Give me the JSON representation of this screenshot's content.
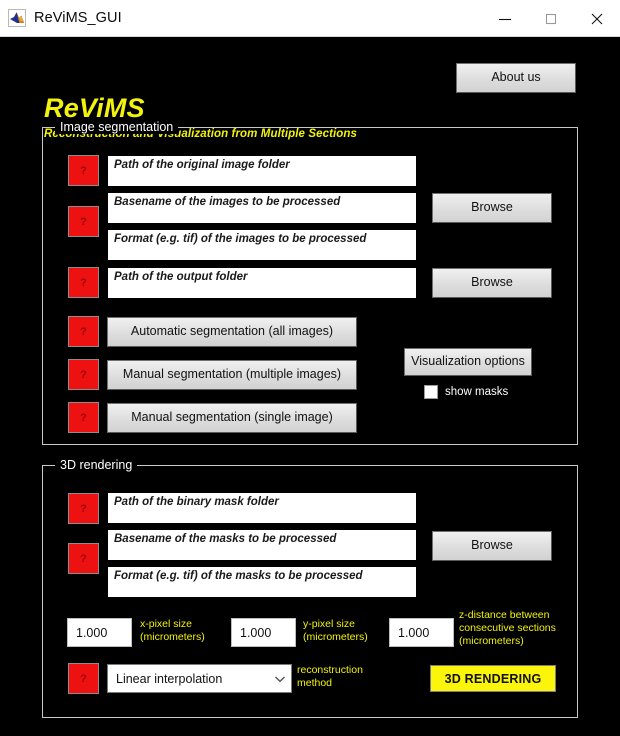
{
  "window": {
    "title": "ReViMS_GUI",
    "icon": "matlab-icon",
    "controls": {
      "minimize": "minimize-icon",
      "maximize": "maximize-icon",
      "close": "close-icon"
    }
  },
  "brand": {
    "title": "ReViMS",
    "subtitle": "Reconstruction and Visualization from Multiple Sections",
    "about_label": "About us",
    "title_color": "#f2f20d"
  },
  "segmentation": {
    "group_label": "Image segmentation",
    "help_label": "?",
    "fields": [
      {
        "name": "original-image-folder",
        "placeholder": "Path of the original image folder",
        "value": ""
      },
      {
        "name": "images-basename",
        "placeholder": "Basename of the images to be processed",
        "value": ""
      },
      {
        "name": "images-format",
        "placeholder": "Format (e.g. tif) of the images to be processed",
        "value": ""
      },
      {
        "name": "output-folder",
        "placeholder": "Path of the output folder",
        "value": ""
      }
    ],
    "browse_label": "Browse",
    "actions": [
      "Automatic segmentation (all images)",
      "Manual segmentation (multiple images)",
      "Manual segmentation (single image)"
    ],
    "visualization_options_label": "Visualization options",
    "show_masks_label": "show masks",
    "show_masks_checked": false
  },
  "rendering": {
    "group_label": "3D rendering",
    "help_label": "?",
    "fields": [
      {
        "name": "binary-mask-folder",
        "placeholder": "Path of the binary mask folder",
        "value": ""
      },
      {
        "name": "masks-basename",
        "placeholder": "Basename of the masks to be processed",
        "value": ""
      },
      {
        "name": "masks-format",
        "placeholder": "Format (e.g. tif) of the masks to be processed",
        "value": ""
      }
    ],
    "browse_label": "Browse",
    "x_pixel_value": "1.000",
    "x_pixel_label_line1": "x-pixel size",
    "x_pixel_label_line2": "(micrometers)",
    "y_pixel_value": "1.000",
    "y_pixel_label_line1": "y-pixel size",
    "y_pixel_label_line2": "(micrometers)",
    "z_distance_value": "1.000",
    "z_distance_label_line1": "z-distance between",
    "z_distance_label_line2": "consecutive sections",
    "z_distance_label_line3": "(micrometers)",
    "method_selected": "Linear interpolation",
    "method_label_line1": "reconstruction",
    "method_label_line2": "method",
    "render_button_label": "3D RENDERING",
    "render_button_color": "#fbf40b"
  }
}
